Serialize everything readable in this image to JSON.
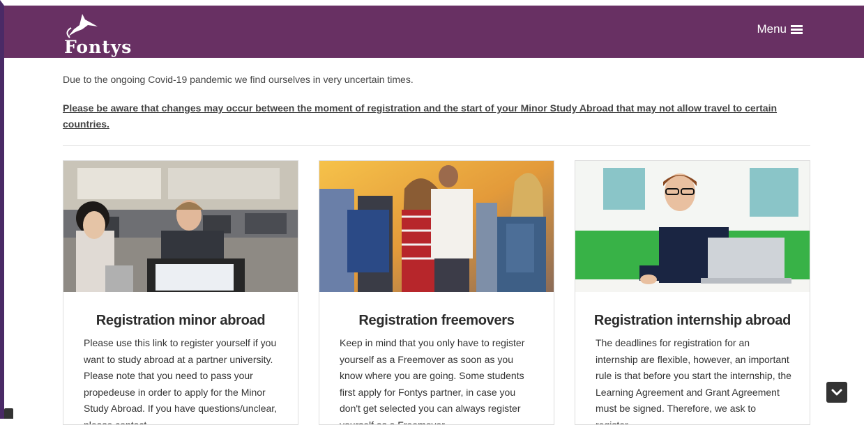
{
  "header": {
    "logo_text": "Fontys",
    "menu_label": "Menu",
    "background": "#683063"
  },
  "notice": {
    "text": "Due to the ongoing Covid-19 pandemic we find ourselves in very uncertain times.",
    "warning": "Please be aware that changes may occur between the moment of registration and the start of your Minor Study Abroad that may not allow travel to certain countries."
  },
  "cards": [
    {
      "title": "Registration minor abroad",
      "image": "students-in-computer-lab",
      "text": "Please use this link to register yourself if you want to study abroad at a partner university. Please note that you need to pass your propedeuse in order to apply for the Minor Study Abroad. If you have questions/unclear, please contact..."
    },
    {
      "title": "Registration freemovers",
      "image": "students-with-backpacks",
      "text": "Keep in mind that you only have to register yourself as a Freemover as soon as you know where you are going. Some students first apply for Fontys partner, in case you don't get selected you can always register yourself as a Freemover."
    },
    {
      "title": "Registration internship abroad",
      "image": "student-with-laptop",
      "text": "The deadlines for registration for an internship are flexible, however, an important rule is that before you start the internship, the Learning Agreement and Grant Agreement must be signed. Therefore, we ask to register..."
    }
  ],
  "icons": {
    "scroll": "chevron-down-icon",
    "menu": "hamburger-icon",
    "logo": "swallow-logo-icon"
  }
}
